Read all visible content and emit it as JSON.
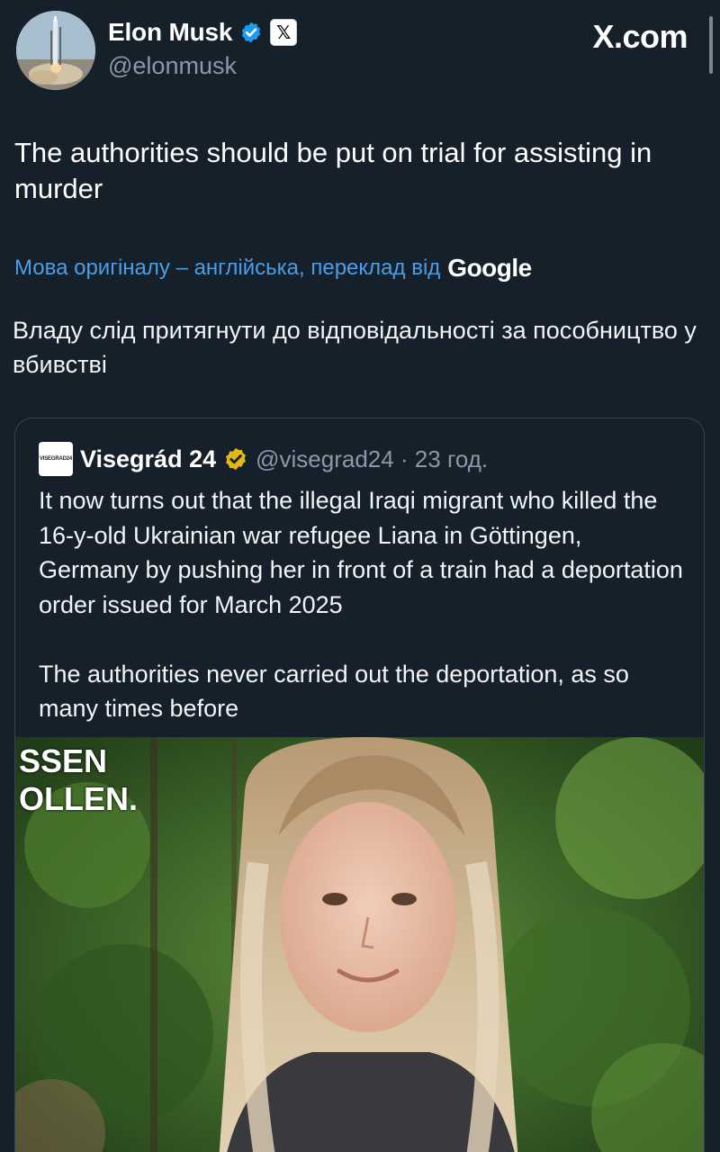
{
  "author": {
    "name": "Elon Musk",
    "handle": "@elonmusk",
    "verified_icon": "verified-badge-icon",
    "affiliate_icon": "x-affiliate-icon"
  },
  "brand": "X.com",
  "tweet": {
    "text": "The authorities should be put on trial for assisting in murder"
  },
  "translation": {
    "label": "Мова оригіналу – англійська, переклад від",
    "provider": "Google",
    "text": "Владу слід притягнути до відповідальності за пособництво у вбивстві"
  },
  "quote": {
    "avatar_text": "VISEGRAD24",
    "name": "Visegrád 24",
    "handle_time": "@visegrad24 · 23 год.",
    "paragraphs": [
      "It now turns out that the illegal Iraqi migrant who killed the 16-y-old Ukrainian war refugee Liana in Göttingen, Germany by pushing her in front of a train had a deportation order issued for March 2025",
      "The authorities never carried out the deportation, as so many times before"
    ],
    "image_overlay_text": [
      "SSEN",
      "OLLEN."
    ]
  },
  "colors": {
    "background": "#15202b",
    "link": "#4a9ee6",
    "verified_blue": "#1d9bf0",
    "verified_gold": "#e2b719",
    "muted": "#8b98a5"
  }
}
